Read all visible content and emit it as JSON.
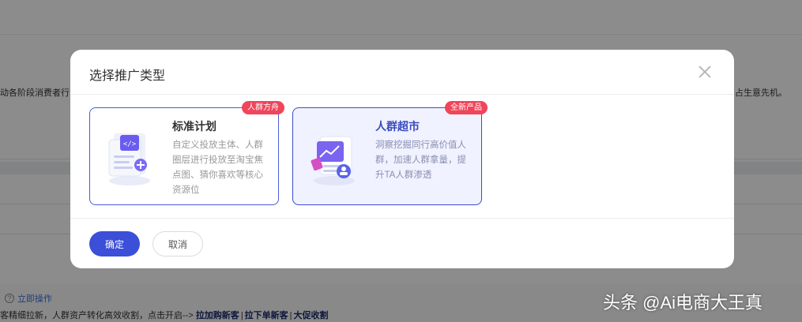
{
  "background": {
    "left_text": "动各阶段消费者行",
    "right_text": "占生意先机。",
    "action_link": "立即操作",
    "description_prefix": "客精细拉新，人群资产转化高效收割，点击开启-->",
    "links": [
      "拉加购新客",
      "拉下单新客",
      "大促收割"
    ],
    "separator": "|"
  },
  "modal": {
    "title": "选择推广类型",
    "cards": [
      {
        "badge": "人群方舟",
        "title": "标准计划",
        "description": "自定义投放主体、人群圈层进行投放至淘宝焦点图、猜你喜欢等核心资源位",
        "selected": false
      },
      {
        "badge": "全新产品",
        "title": "人群超市",
        "description": "洞察挖掘同行高价值人群，加速人群拿量，提升TA人群渗透",
        "selected": true
      }
    ],
    "confirm_label": "确定",
    "cancel_label": "取消"
  },
  "watermark": "头条 @Ai电商大王真",
  "colors": {
    "accent": "#3b4fd9",
    "badge": "#f0455a",
    "selected_bg": "#f0f2ff"
  },
  "icons": [
    "close-icon",
    "question-circle-icon",
    "document-code-illustration",
    "crowd-chart-illustration"
  ]
}
